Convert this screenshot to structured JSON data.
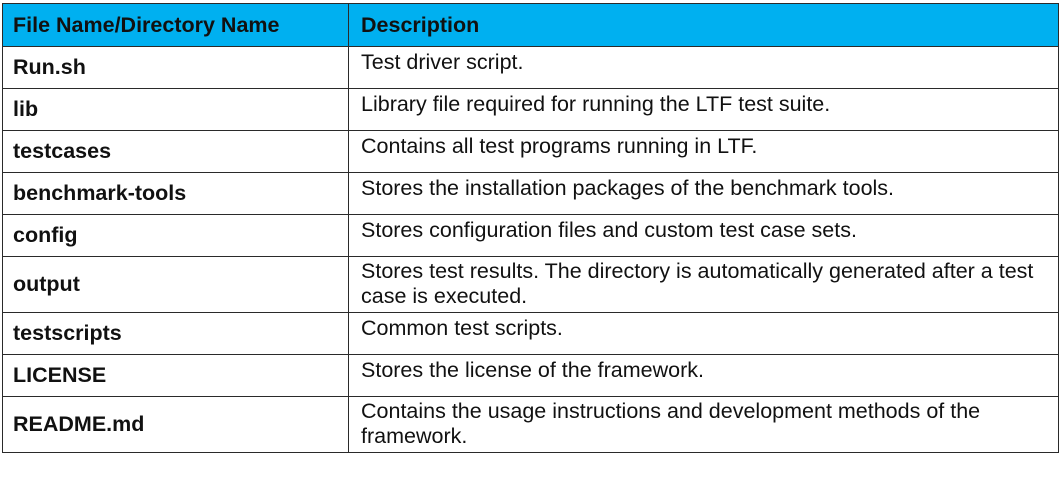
{
  "table": {
    "headers": [
      "File Name/Directory Name",
      "Description"
    ],
    "rows": [
      {
        "name": "Run.sh",
        "description": "Test driver script."
      },
      {
        "name": "lib",
        "description": "Library file required for running the LTF test suite."
      },
      {
        "name": "testcases",
        "description": "Contains all test programs running in LTF."
      },
      {
        "name": "benchmark-tools",
        "description": "Stores the installation packages of the benchmark tools."
      },
      {
        "name": "config",
        "description": "Stores configuration files and custom test case sets."
      },
      {
        "name": "output",
        "description": "Stores test results. The directory is automatically generated after a test case is executed."
      },
      {
        "name": "testscripts",
        "description": "Common test scripts."
      },
      {
        "name": "LICENSE",
        "description": "Stores the license of the framework."
      },
      {
        "name": "README.md",
        "description": "Contains the usage instructions and development methods of the framework."
      }
    ],
    "header_color": "#00b0f0"
  }
}
